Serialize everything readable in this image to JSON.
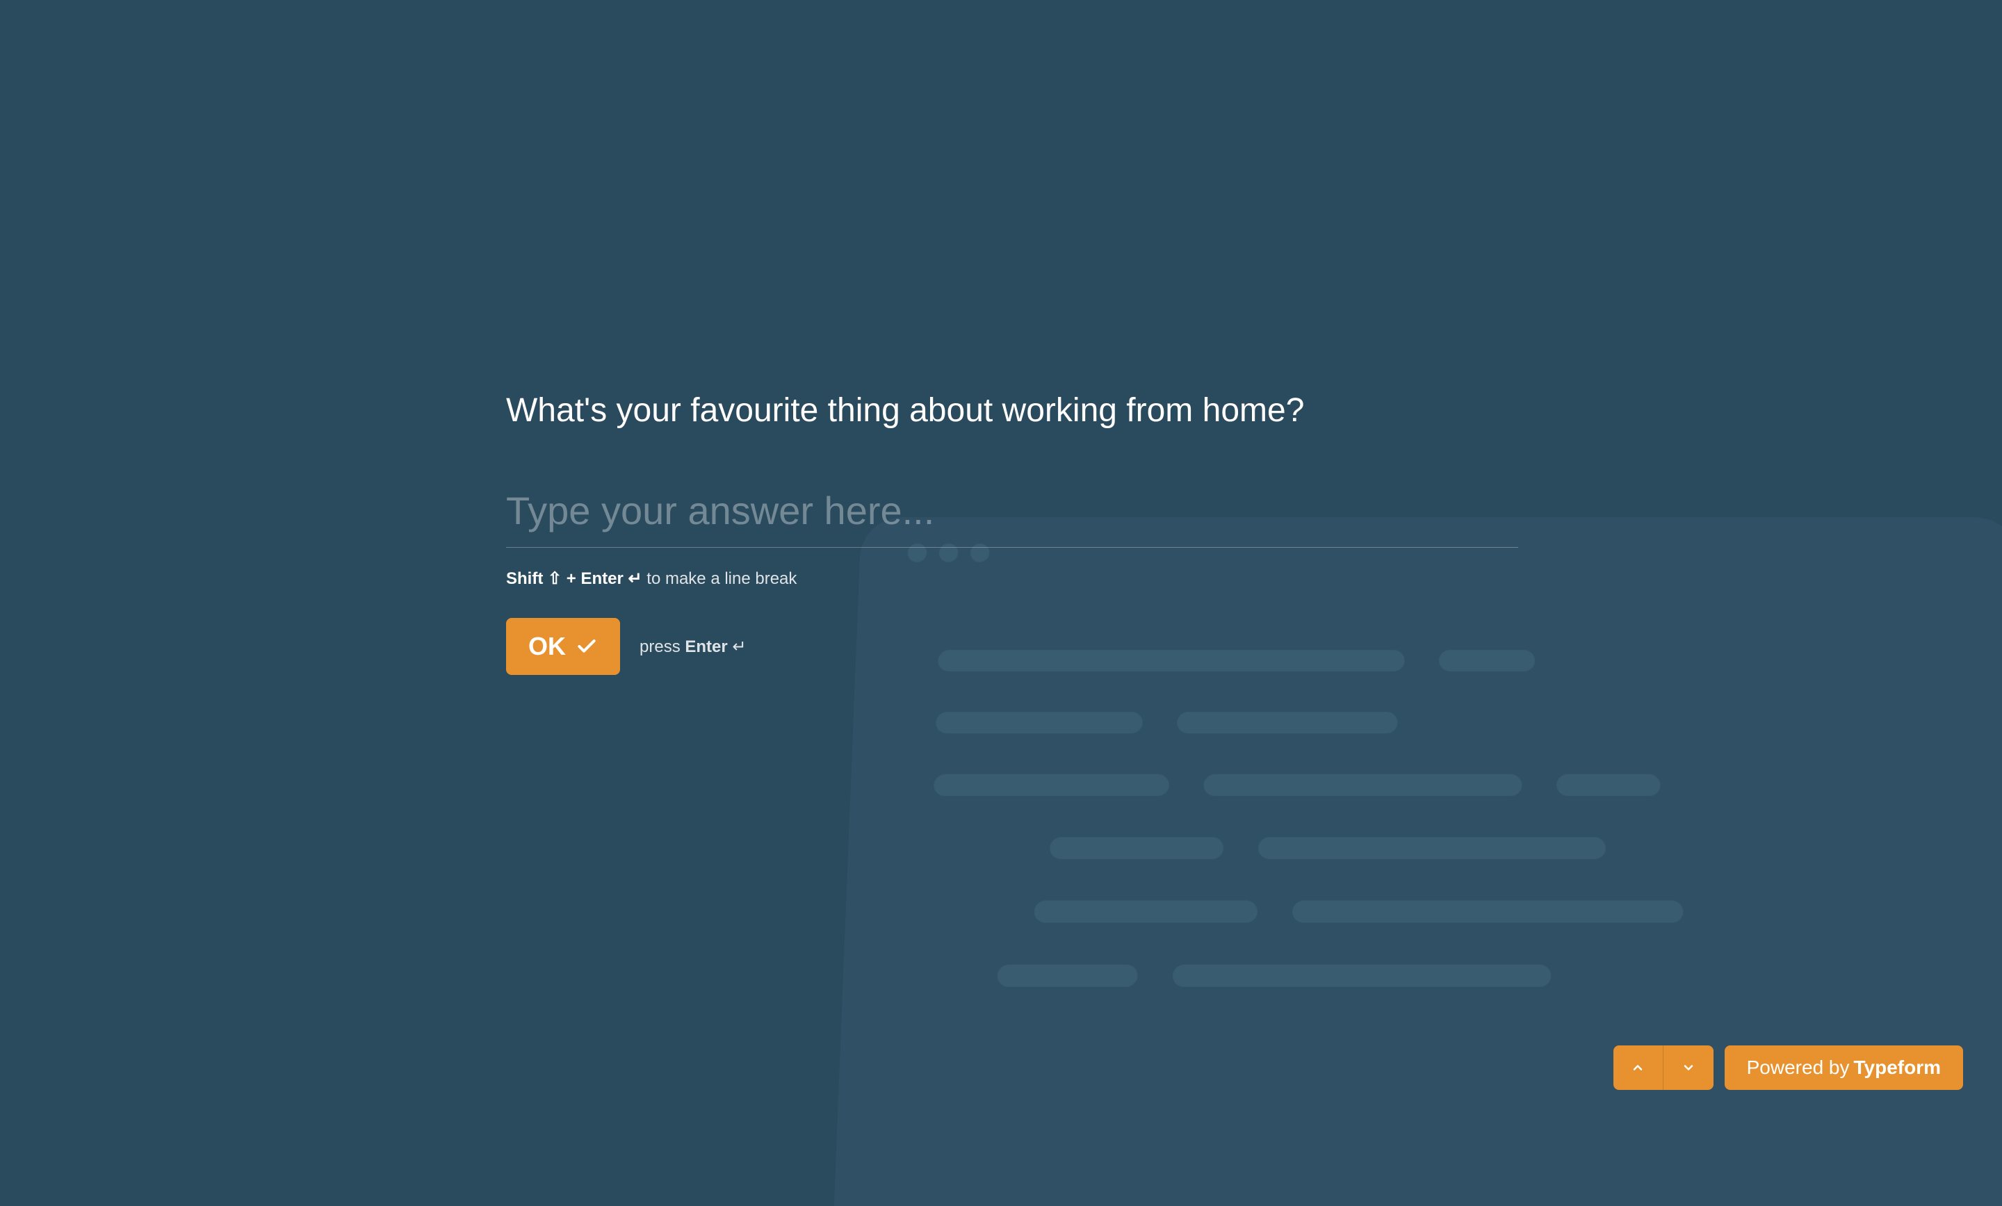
{
  "question": {
    "title": "What's your favourite thing about working from home?",
    "placeholder": "Type your answer here..."
  },
  "hints": {
    "shift": "Shift",
    "shift_symbol": "⇧",
    "plus": "+",
    "enter": "Enter",
    "enter_symbol": "↵",
    "line_break": "to make a line break",
    "press": "press"
  },
  "buttons": {
    "ok": "OK"
  },
  "footer": {
    "powered_by": "Powered by",
    "brand": "Typeform"
  },
  "colors": {
    "background": "#2a4a5e",
    "accent": "#e8922f",
    "illustration": "#34576d"
  }
}
